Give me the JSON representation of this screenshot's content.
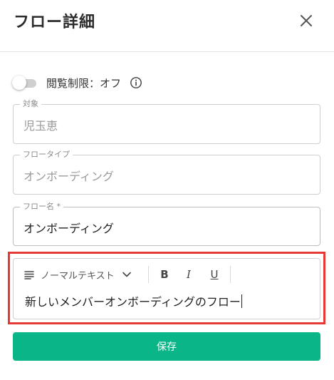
{
  "header": {
    "title": "フロー詳細"
  },
  "visibility": {
    "label": "閲覧制限：オフ",
    "enabled": false
  },
  "fields": {
    "target": {
      "legend": "対象",
      "value": "児玉恵"
    },
    "flow_type": {
      "legend": "フロータイプ",
      "value": "オンボーディング"
    },
    "flow_name": {
      "legend": "フロー名 *",
      "value": "オンボーディング"
    }
  },
  "editor": {
    "format_label": "ノーマルテキスト",
    "bold": "B",
    "italic": "I",
    "underline": "U",
    "content": "新しいメンバーオンボーディングのフロー"
  },
  "save_label": "保存",
  "colors": {
    "accent": "#0ab587",
    "highlight": "#e53935"
  },
  "icons": [
    "close-icon",
    "info-icon",
    "text-lines-icon",
    "chevron-down-icon"
  ]
}
